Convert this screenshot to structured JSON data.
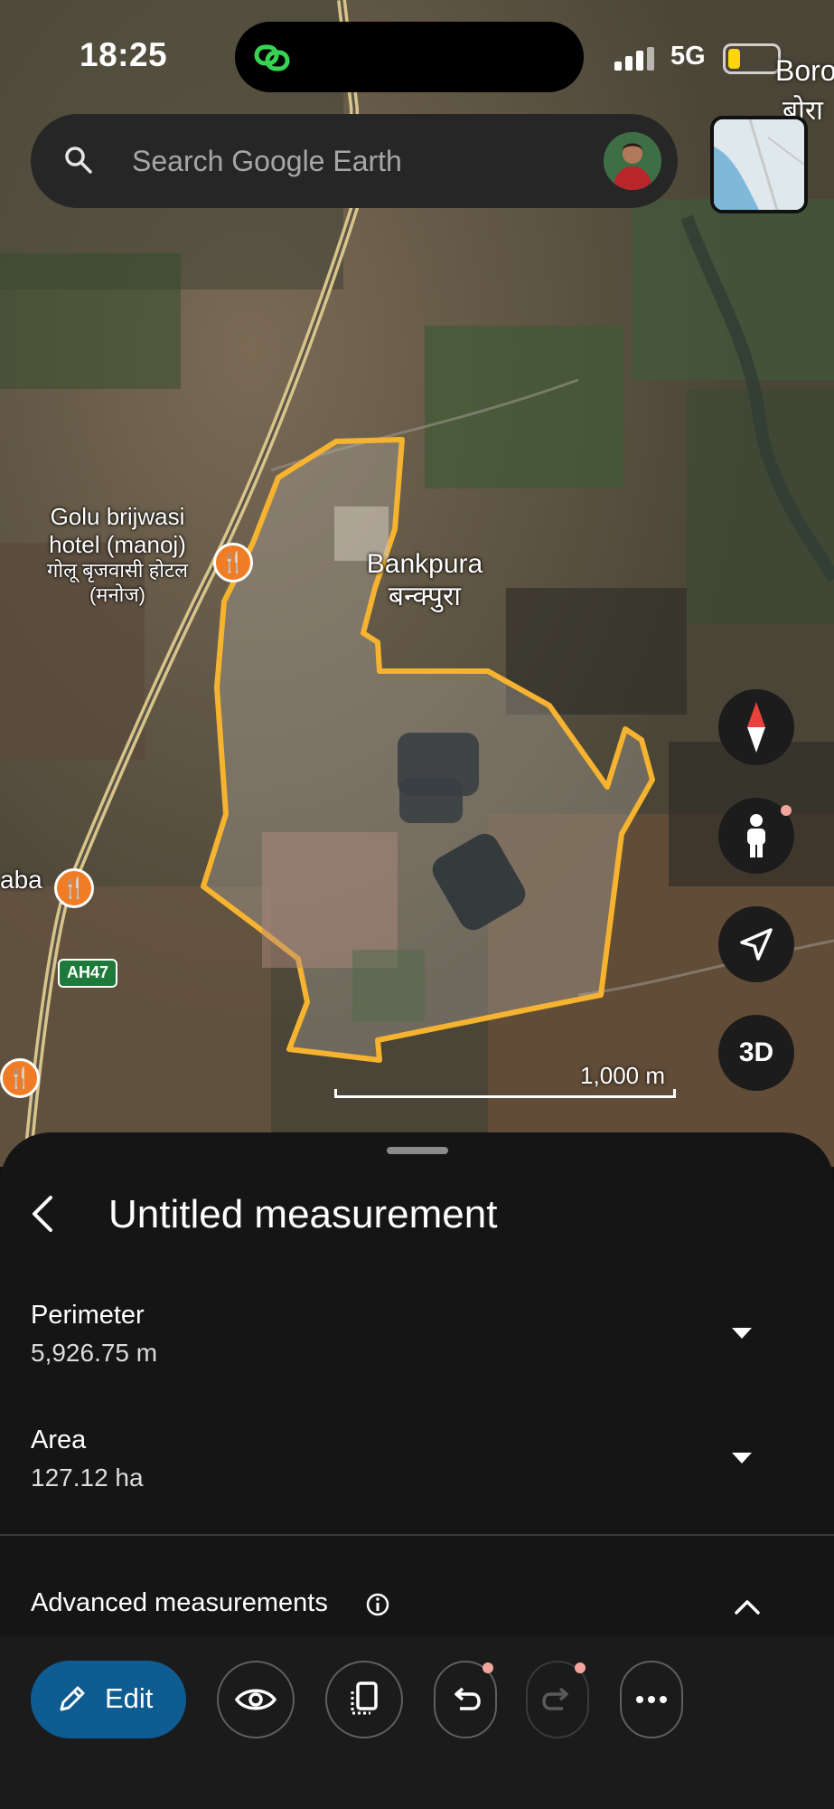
{
  "status_bar": {
    "time": "18:25",
    "network": "5G",
    "battery_level": 0.25,
    "edge_label_1": "Boro",
    "edge_label_2": "बोरा"
  },
  "search": {
    "placeholder": "Search Google Earth",
    "icon": "search-icon"
  },
  "map": {
    "places": [
      {
        "name": "Golu brijwasi hotel (manoj)",
        "local_name": "गोलू बृजवासी होटल (मनोज)",
        "icon": "restaurant-icon"
      },
      {
        "name": "Bankpura",
        "local_name": "बन्क्पुरा"
      },
      {
        "name": "aba",
        "icon": "restaurant-icon"
      }
    ],
    "highway_shield": "AH47",
    "scale_label": "1,000 m",
    "polygon_color": "#f5b330",
    "controls": {
      "compass": "compass-icon",
      "street_view": "pegman-icon",
      "my_location": "navigation-arrow-icon",
      "three_d": "3D"
    }
  },
  "sheet": {
    "title": "Untitled measurement",
    "metrics": [
      {
        "label": "Perimeter",
        "value": "5,926.75 m"
      },
      {
        "label": "Area",
        "value": "127.12 ha"
      }
    ],
    "advanced_label": "Advanced measurements",
    "toolbar": {
      "edit_label": "Edit",
      "accent_color": "#0e5c91",
      "buttons": [
        "eye-icon",
        "copy-icon",
        "undo-icon",
        "redo-icon",
        "more-icon"
      ]
    }
  }
}
